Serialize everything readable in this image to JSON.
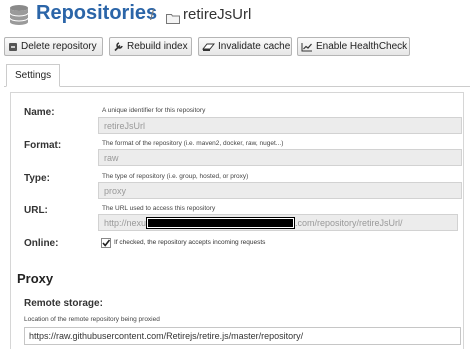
{
  "header": {
    "title": "Repositories",
    "separator": "/",
    "repo_name": "retireJsUrl"
  },
  "toolbar": {
    "delete_label": "Delete repository",
    "rebuild_label": "Rebuild index",
    "invalidate_label": "Invalidate cache",
    "healthcheck_label": "Enable HealthCheck"
  },
  "tabs": [
    {
      "label": "Settings"
    }
  ],
  "form": {
    "name": {
      "label": "Name:",
      "help": "A unique identifier for this repository",
      "value": "retireJsUrl"
    },
    "format": {
      "label": "Format:",
      "help": "The format of the repository (i.e. maven2, docker, raw, nuget...)",
      "value": "raw"
    },
    "type": {
      "label": "Type:",
      "help": "The type of repository (i.e. group, hosted, or proxy)",
      "value": "proxy"
    },
    "url": {
      "label": "URL:",
      "help": "The URL used to access this repository",
      "value_prefix": "http://nexu",
      "value_suffix": ".com/repository/retireJsUrl/"
    },
    "online": {
      "label": "Online:",
      "checked": true,
      "text": "If checked, the repository accepts incoming requests"
    }
  },
  "proxy": {
    "section_title": "Proxy",
    "remote_storage_label": "Remote storage:",
    "remote_storage_help": "Location of the remote repository being proxied",
    "remote_storage_value": "https://raw.githubusercontent.com/Retirejs/retire.js/master/repository/"
  },
  "colors": {
    "title": "#2b65a8",
    "readonly_field": "#ececec"
  },
  "icons": [
    "database-icon",
    "folder-icon",
    "trash-icon",
    "wrench-icon",
    "eraser-icon",
    "chart-icon",
    "checkmark-icon"
  ]
}
